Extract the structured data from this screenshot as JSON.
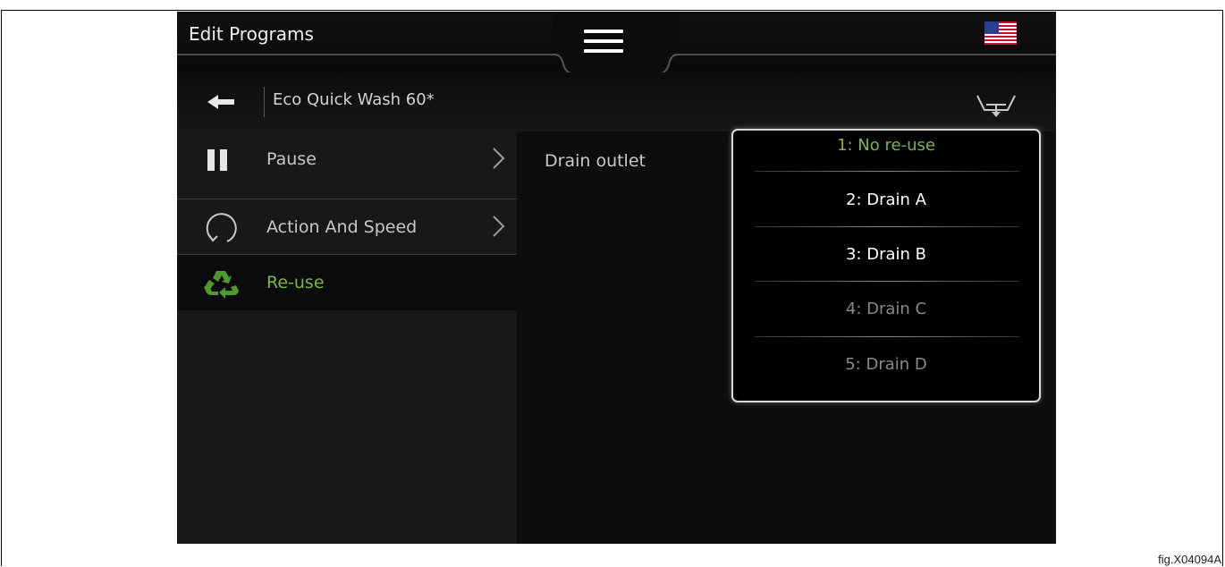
{
  "header": {
    "title": "Edit Programs",
    "menu_icon": "hamburger-icon",
    "flag_icon": "us-flag-icon"
  },
  "breadcrumb": {
    "program": "Eco Quick Wash 60*",
    "back_icon": "back-arrow-icon",
    "drain_icon": "drain-outlet-icon"
  },
  "menu": {
    "items": [
      {
        "label": "Pause",
        "icon": "pause-icon",
        "selected": false,
        "has_arrow": true
      },
      {
        "label": "Action And Speed",
        "icon": "rotation-icon",
        "selected": false,
        "has_arrow": true
      },
      {
        "label": "Re-use",
        "icon": "recycle-icon",
        "selected": true,
        "has_arrow": false
      }
    ]
  },
  "setting": {
    "label": "Drain outlet"
  },
  "dropdown": {
    "options": [
      {
        "label": "1: No re-use",
        "state": "selected",
        "color": "#76b843"
      },
      {
        "label": "2: Drain A",
        "state": "enabled",
        "color": "#ffffff"
      },
      {
        "label": "3: Drain B",
        "state": "enabled",
        "color": "#ffffff"
      },
      {
        "label": "4: Drain C",
        "state": "disabled",
        "color": "#8a8a8e"
      },
      {
        "label": "5: Drain D",
        "state": "disabled",
        "color": "#8a8a8e"
      }
    ]
  },
  "colors": {
    "accent": "#76b843",
    "background": "#0a0a0c"
  },
  "figure_label": "fig.X04094A"
}
